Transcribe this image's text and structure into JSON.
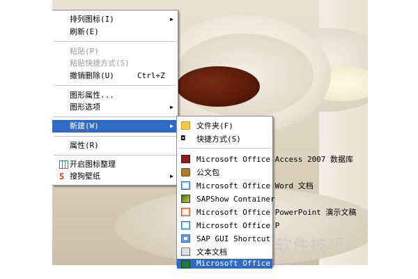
{
  "context_menu": {
    "items": [
      {
        "label": "排列图标(I)",
        "has_submenu": true
      },
      {
        "label": "刷新(E)"
      },
      {
        "label": "粘贴(P)",
        "disabled": true
      },
      {
        "label": "粘贴快捷方式(S)",
        "disabled": true
      },
      {
        "label": "撤销删除(U)",
        "shortcut": "Ctrl+Z"
      },
      {
        "label": "图形属性..."
      },
      {
        "label": "图形选项",
        "has_submenu": true
      },
      {
        "label": "新建(W)",
        "has_submenu": true,
        "highlighted": true
      },
      {
        "label": "属性(R)"
      },
      {
        "label": "开启图标整理",
        "icon": "grid-icon"
      },
      {
        "label": "搜狗壁纸",
        "icon": "sogou-icon",
        "has_submenu": true
      }
    ]
  },
  "new_submenu": {
    "items": [
      {
        "label": "文件夹(F)",
        "icon": "folder-icon"
      },
      {
        "label": "快捷方式(S)",
        "icon": "shortcut-icon"
      },
      {
        "label": "Microsoft Office Access 2007 数据库",
        "icon": "access-icon"
      },
      {
        "label": "公文包",
        "icon": "briefcase-icon"
      },
      {
        "label": "Microsoft Office Word 文档",
        "icon": "word-icon"
      },
      {
        "label": "SAPShow Container",
        "icon": "sap-show-icon"
      },
      {
        "label": "Microsoft Office PowerPoint 演示文稿",
        "icon": "powerpoint-icon"
      },
      {
        "label": "Microsoft Office P",
        "icon": "publisher-icon"
      },
      {
        "label": "SAP GUI Shortcut",
        "icon": "sap-gui-icon"
      },
      {
        "label": "文本文档",
        "icon": "text-document-icon"
      },
      {
        "label": "Microsoft Office E",
        "icon": "excel-icon",
        "highlighted": true
      }
    ]
  },
  "watermark": "软件技巧",
  "colors": {
    "highlight": "#316ac5",
    "disabled_text": "#9a9a9a"
  }
}
